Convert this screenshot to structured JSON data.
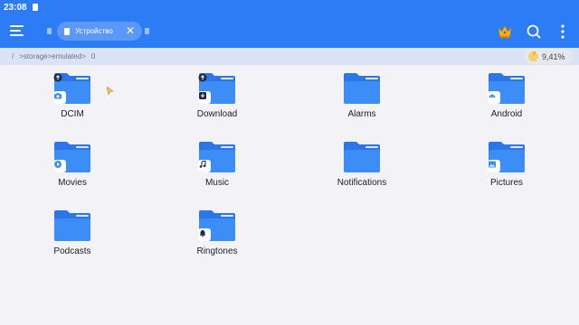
{
  "statusbar": {
    "time": "23:08"
  },
  "appbar": {
    "tab_label": "Устройство",
    "icons": [
      "menu-icon",
      "crown-icon",
      "search-icon",
      "more-vertical-icon"
    ]
  },
  "pathbar": {
    "root": "/",
    "seg1": ">storage",
    "seg2": ">emulated",
    "seg3": ">",
    "seg4": "0",
    "storage_usage": "9,41%"
  },
  "colors": {
    "accent": "#2c7cf5",
    "folder": "#3d8df6",
    "folder_back": "#2b76e8"
  },
  "folders": [
    {
      "name": "DCIM",
      "badge": "camera-icon"
    },
    {
      "name": "Download",
      "badge": "download-icon"
    },
    {
      "name": "Alarms",
      "badge": ""
    },
    {
      "name": "Android",
      "badge": "android-icon"
    },
    {
      "name": "Movies",
      "badge": "play-icon"
    },
    {
      "name": "Music",
      "badge": "music-note-icon"
    },
    {
      "name": "Notifications",
      "badge": ""
    },
    {
      "name": "Pictures",
      "badge": "image-icon"
    },
    {
      "name": "Podcasts",
      "badge": ""
    },
    {
      "name": "Ringtones",
      "badge": "bell-icon"
    }
  ]
}
